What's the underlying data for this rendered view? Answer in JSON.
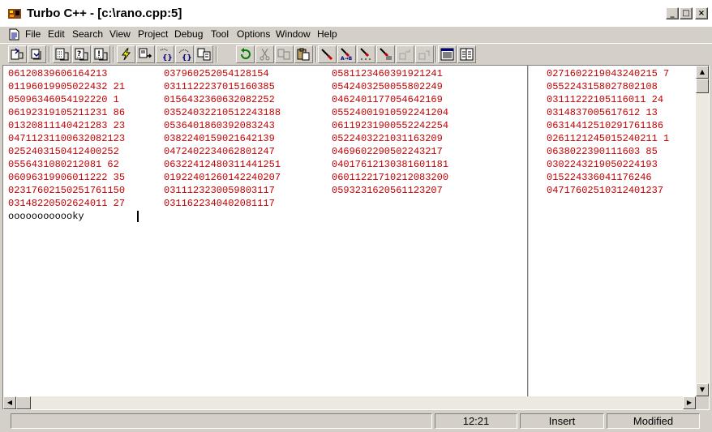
{
  "window": {
    "title": "Turbo C++ - [c:\\rano.cpp:5]",
    "minimize_glyph": "_",
    "maximize_glyph": "□",
    "close_glyph": "×",
    "mdi_minimize_glyph": "_",
    "mdi_restore_glyph": "⧉",
    "mdi_close_glyph": "×"
  },
  "menu": {
    "items": [
      "File",
      "Edit",
      "Search",
      "View",
      "Project",
      "Debug",
      "Tool",
      "Options",
      "Window",
      "Help"
    ]
  },
  "toolbar": {
    "buttons": [
      "open-project-icon",
      "save-project-icon",
      "binary-file-icon",
      "binary-file-query-icon",
      "binary-file-info-icon",
      "make-lightning-icon",
      "step-into-icon",
      "trace-into-icon",
      "step-over-icon",
      "run-to-icon",
      "undo-icon",
      "cut-icon",
      "copy-icon",
      "paste-icon",
      "find-icon",
      "replace-icon",
      "search-again-icon",
      "add-breakpoint-icon",
      "browse-back-icon",
      "browse-forward-icon",
      "window-tile-icon",
      "window-cascade-icon"
    ]
  },
  "editor": {
    "columns": [
      [
        "06120839606164213",
        "01196019905022432 21",
        "05096346054192220 1",
        "06192319105211231 86",
        "01320811140421283 23",
        "04711231100632082123",
        "0252403150412400252",
        "0556431080212081 62",
        "06096319906011222 35",
        "02317602150251761150",
        "03148220502624011 27"
      ],
      [
        "037960252054128154",
        "0311122237015160385",
        "0156432360632082252",
        "03524032210512243188",
        "0536401860392083243",
        "0382240159021642139",
        "0472402234062801247",
        "06322412480311441251",
        "01922401260142240207",
        "0311123230059803117",
        "0311622340402081117"
      ],
      [
        "0581123460391921241",
        "0542403250055802249",
        "0462401177054642169",
        "05524001910592241204",
        "06119231900552242254",
        "0522403221031163209",
        "0469602290502243217",
        "04017612130381601181",
        "06011221710212083200",
        "0593231620561123207"
      ],
      [
        "0271602219043240215 7",
        "0552243158027802108",
        "03111222105116011 24",
        "0314837005617612 13",
        "06314412510291761186",
        "0261121245015240211 1",
        "0638022390111603 85",
        "0302243219050224193",
        "015224336041176246",
        "04717602510312401237"
      ]
    ],
    "last_line": "oooooooooooky"
  },
  "status": {
    "message": "",
    "position": "12:21",
    "mode": "Insert",
    "state": "Modified"
  },
  "colors": {
    "number_text": "#c00000",
    "chrome": "#d4d0c8"
  }
}
